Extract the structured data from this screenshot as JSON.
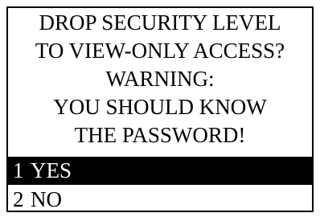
{
  "dialog": {
    "message_lines": [
      "DROP SECURITY LEVEL",
      "TO VIEW-ONLY ACCESS?",
      "WARNING:",
      "YOU SHOULD KNOW",
      "THE PASSWORD!"
    ],
    "options": [
      {
        "number": "1",
        "label": "YES",
        "selected": true
      },
      {
        "number": "2",
        "label": "NO",
        "selected": false
      }
    ]
  },
  "colors": {
    "background": "#ffffff",
    "text": "#000000",
    "highlight_background": "#000000",
    "highlight_text": "#ffffff"
  }
}
